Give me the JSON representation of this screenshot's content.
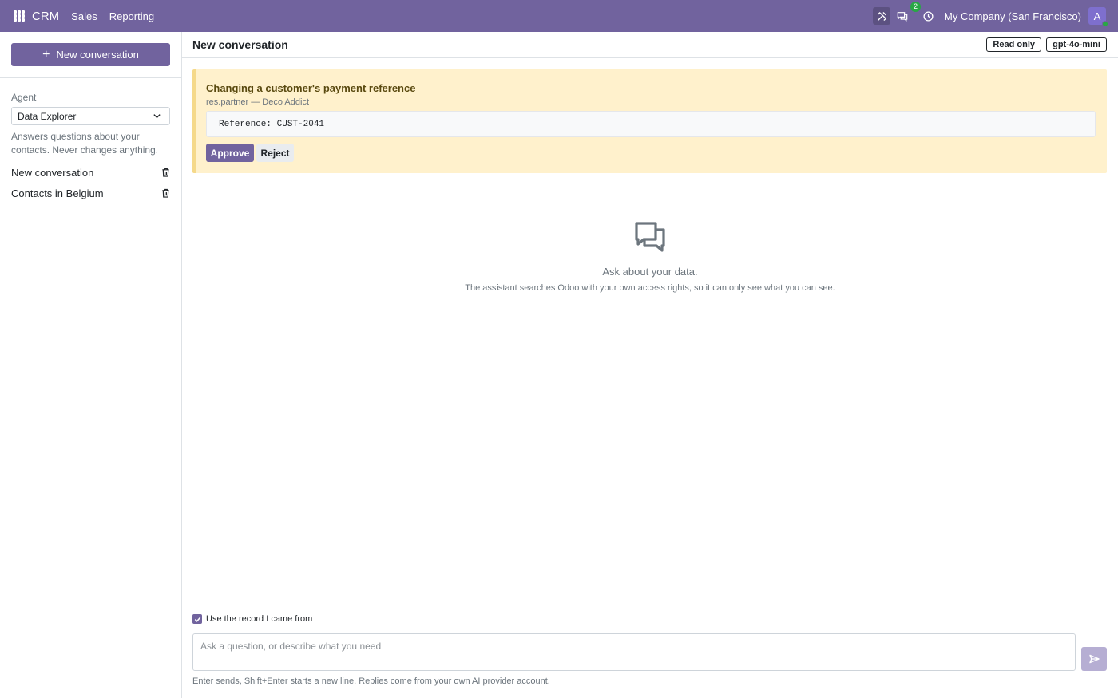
{
  "navbar": {
    "app_name": "CRM",
    "menus": [
      "Sales",
      "Reporting"
    ],
    "chat_badge": "2",
    "company": "My Company (San Francisco)",
    "avatar_initial": "A",
    "accent_color": "#71639e"
  },
  "sidebar": {
    "new_conversation_label": "New conversation",
    "agent_label": "Agent",
    "agent_selected": "Data Explorer",
    "agent_description": "Answers questions about your contacts. Never changes anything.",
    "conversations": [
      {
        "label": "New conversation"
      },
      {
        "label": "Contacts in Belgium"
      }
    ]
  },
  "header": {
    "title": "New conversation",
    "mode_tag": "Read only",
    "model_tag": "gpt-4o-mini"
  },
  "approval": {
    "title": "Changing a customer's payment reference",
    "subtitle": "res.partner — Deco Addict",
    "code": "Reference: CUST-2041",
    "approve_label": "Approve",
    "reject_label": "Reject"
  },
  "empty_state": {
    "title": "Ask about your data.",
    "description": "The assistant searches Odoo with your own access rights, so it can only see what you can see."
  },
  "composer": {
    "use_record_label": "Use the record I came from",
    "use_record_checked": true,
    "placeholder": "Ask a question, or describe what you need",
    "hint": "Enter sends, Shift+Enter starts a new line. Replies come from your own AI provider account."
  }
}
